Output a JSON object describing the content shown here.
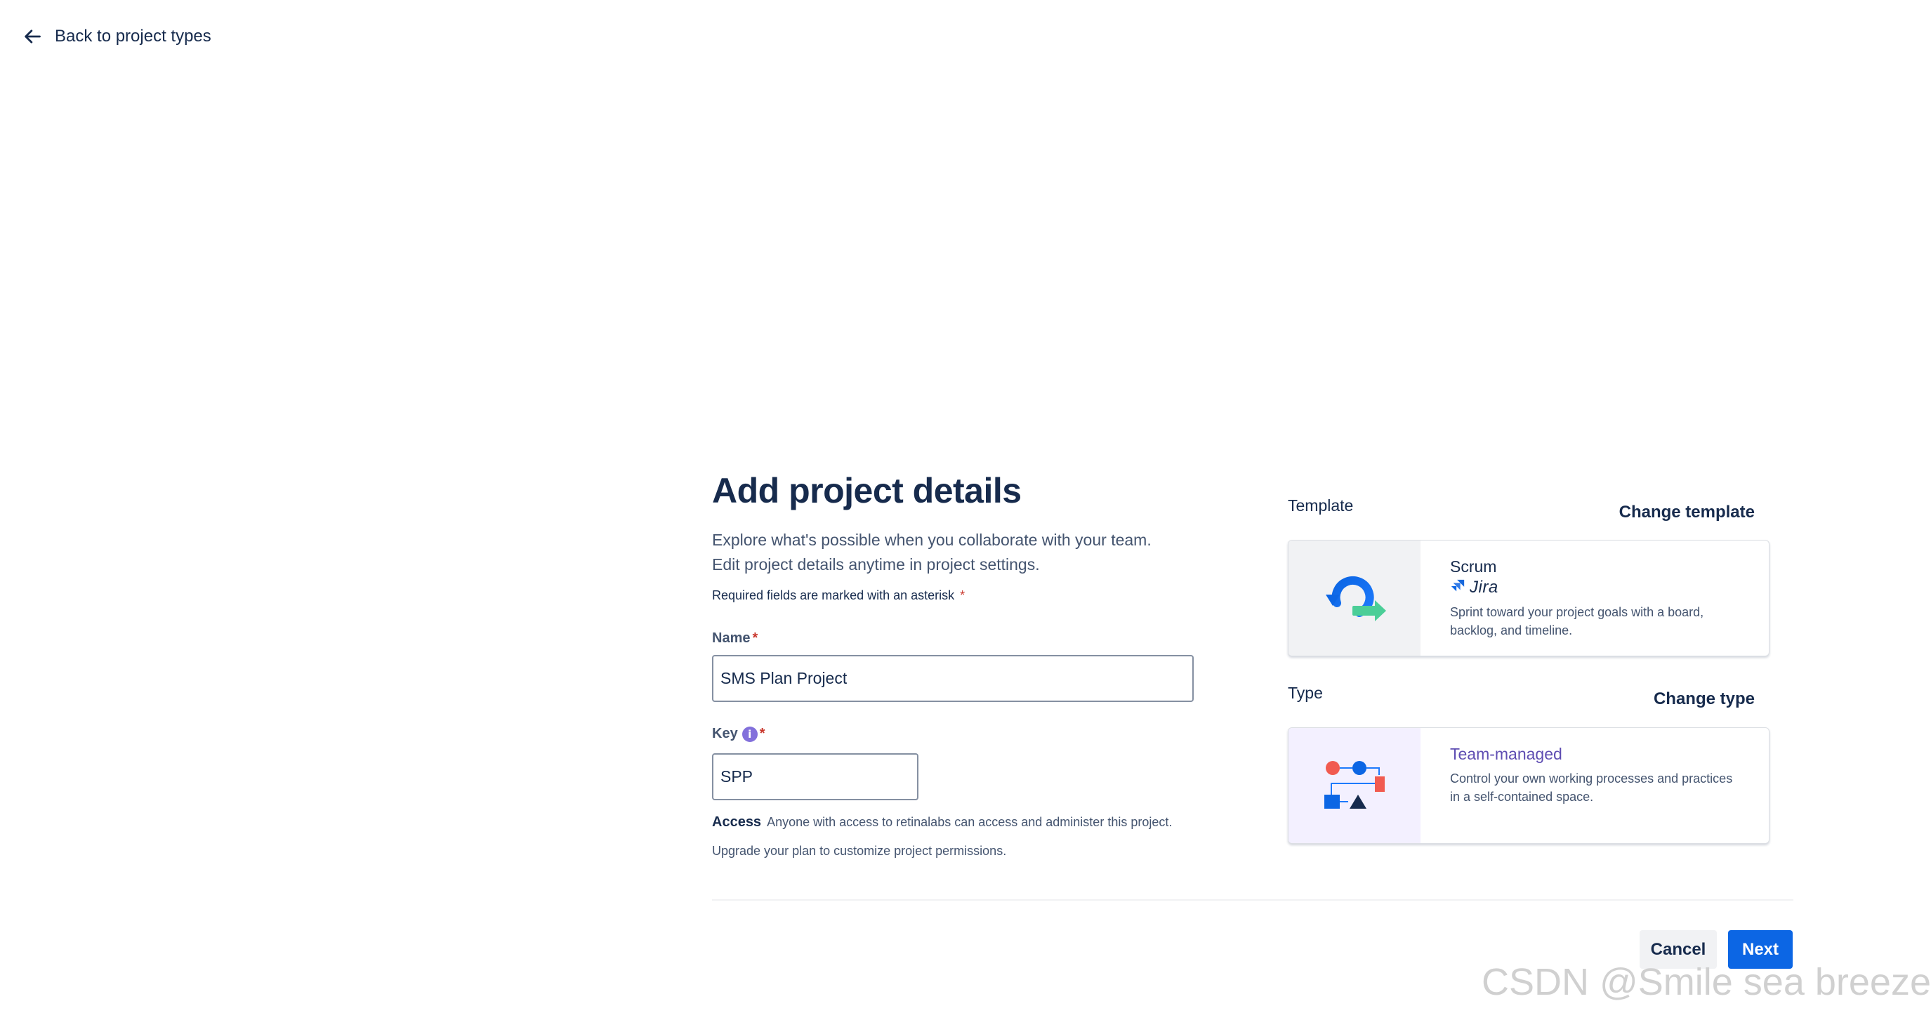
{
  "nav": {
    "back_label": "Back to project types"
  },
  "form": {
    "title": "Add project details",
    "description_line1": "Explore what's possible when you collaborate with your team.",
    "description_line2": "Edit project details anytime in project settings.",
    "required_note": "Required fields are marked with an asterisk",
    "required_star": "*",
    "name_label": "Name",
    "name_value": "SMS Plan Project",
    "key_label": "Key",
    "key_info_glyph": "i",
    "key_value": "SPP",
    "access_label": "Access",
    "access_text": "Anyone with access to retinalabs can access and administer this project.",
    "upgrade_text": "Upgrade your plan to customize project permissions."
  },
  "template": {
    "section_label": "Template",
    "change_label": "Change template",
    "name": "Scrum",
    "product": "Jira",
    "description": "Sprint toward your project goals with a board, backlog, and timeline."
  },
  "type": {
    "section_label": "Type",
    "change_label": "Change type",
    "name": "Team-managed",
    "description": "Control your own working processes and practices in a self-contained space."
  },
  "actions": {
    "cancel_label": "Cancel",
    "next_label": "Next"
  },
  "watermark": "CSDN @Smile sea breeze",
  "colors": {
    "primary": "#0c66e4",
    "text": "#172b4d",
    "subtle_text": "#44546f",
    "required": "#c9372c",
    "accent_purple": "#5e4db2"
  }
}
